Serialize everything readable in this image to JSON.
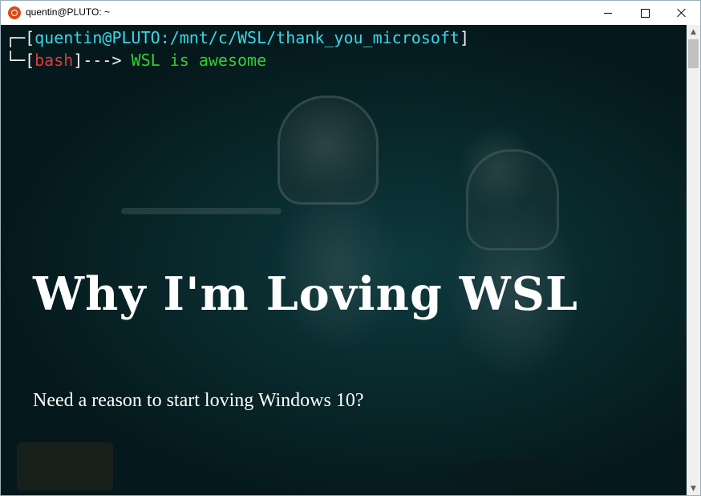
{
  "window": {
    "title": "quentin@PLUTO: ~",
    "icon": "ubuntu-icon",
    "controls": [
      "minimize-icon",
      "maximize-icon",
      "close-icon"
    ]
  },
  "terminal": {
    "line1": {
      "corner": "┌─[",
      "user_host": "quentin@PLUTO",
      "path": ":/mnt/c/WSL/thank_you_microsoft",
      "end": "]"
    },
    "line2": {
      "corner": "└─[",
      "shell": "bash",
      "arrow": "]---> ",
      "message": "WSL is awesome"
    },
    "heading": "Why I'm Loving WSL",
    "subheading": "Need a reason to start loving Windows 10?"
  },
  "colors": {
    "prompt_bracket": "#f2f2f2",
    "user_path": "#3ad7e8",
    "shell": "#e23a3a",
    "message": "#2fd02f",
    "background": "#0d3a3d"
  }
}
